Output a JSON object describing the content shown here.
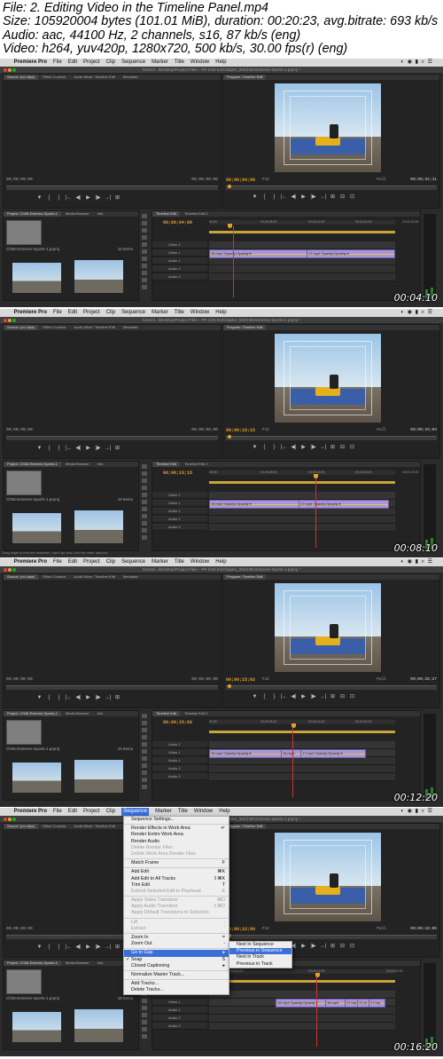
{
  "file_info": {
    "line1": "File: 2. Editing Video in the Timeline Panel.mp4",
    "line2": "Size: 105920004 bytes (101.01 MiB), duration: 00:20:23, avg.bitrate: 693 kb/s",
    "line3": "Audio: aac, 44100 Hz, 2 channels, s16, 87 kb/s (eng)",
    "line4": "Video: h264, yuv420p, 1280x720, 500 kb/s, 30.00 fps(r) (eng)"
  },
  "menubar": {
    "apple": "",
    "app": "Premiere Pro",
    "items": [
      "File",
      "Edit",
      "Project",
      "Clip",
      "Sequence",
      "Marker",
      "Title",
      "Window",
      "Help"
    ],
    "sys": "◐ ◉ ▮ ⌕ ☰"
  },
  "window_title": "/Users/.../Desktop/Project Files – PP CS6 Ex/Chapter_06/Ch06-Extreme-Sports-1.prproj *",
  "panels": {
    "source_tab": "Source: (no clips)",
    "effect_controls_tab": "Effect Controls",
    "audio_mixer_tab": "Audio Mixer: Timeline Edit",
    "metadata_tab": "Metadata",
    "program_tab": "Program: Timeline Edit",
    "project_tab": "Project: Ch06-Extreme-Sports-1",
    "media_browser_tab": "Media Browser",
    "info_tab": "Info",
    "timeline_tab": "Timeline Edit",
    "timeline_tab2": "Timeline Edit 2",
    "project_file": "Ch06-Extreme-Sports-1.prproj",
    "items_count": "15 Items",
    "fit_label": "Fit",
    "full_label": "Full",
    "source_tc_left": "00;00;00;00",
    "source_tc_right": "00;00;00;00"
  },
  "frames": [
    {
      "program_tc": "00;00;04;06",
      "program_duration": "00;00;34;11",
      "timeline_tc": "00;00;04;06",
      "ruler": [
        "00;00",
        "00;00;08;00",
        "00;00;16;00",
        "00;00;24;00",
        "00;00;32;00"
      ],
      "clips": [
        "16.mp4 Opacity:Opacity ▾",
        "17.mp4 Opacity:Opacity ▾"
      ],
      "stamp": "00:04:10",
      "status": ""
    },
    {
      "program_tc": "00;00;19;15",
      "program_duration": "00;00;33;03",
      "timeline_tc": "00;00;19;15",
      "ruler": [
        "00;00",
        "00;00;08;00",
        "00;00;16;00",
        "00;00;24;00",
        "00;00;32;00"
      ],
      "clips": [
        "16.mp4 Opacity:Opacity ▾",
        "17.mp4 Opacity:Opacity ▾"
      ],
      "stamp": "00:08:10",
      "status": "Drag edge to trim the selection. Use Opt and Cmd for other options."
    },
    {
      "program_tc": "00;00;15;02",
      "program_duration": "00;00;28;27",
      "timeline_tc": "00;00;15;02",
      "ruler": [
        "00;00",
        "00;00;08;00",
        "00;00;16;00",
        "00;00;24;00"
      ],
      "clips": [
        "16.mp4 Opacity:Opacity ▾",
        "16.mp4",
        "17.mp4 Opacity:Opacity ▾"
      ],
      "stamp": "00:12:20",
      "status": ""
    },
    {
      "program_tc": "00;00;12;00",
      "program_duration": "00;00;19;09",
      "timeline_tc": "00;00;12;00",
      "ruler": [
        "00;00;04;00",
        "00;00;12;00",
        "00;00;20;00"
      ],
      "clips": [
        "16.mp4 Opacity:Opacity ▾",
        "16.mp4",
        "17.mp",
        "17.m",
        "17.mp"
      ],
      "stamp": "00:16:20",
      "status": ""
    }
  ],
  "tracks": [
    "Video 2",
    "Video 1",
    "Audio 1",
    "Audio 2",
    "Audio 3"
  ],
  "transport_icons": [
    "▼",
    "{",
    "}",
    "|←",
    "◀|",
    "▶",
    "|▶",
    "→|",
    "⊞",
    "⊟",
    "⊡"
  ],
  "sequence_menu": {
    "items": [
      {
        "label": "Sequence Settings...",
        "sc": "",
        "dis": false
      },
      {
        "sep": true
      },
      {
        "label": "Render Effects in Work Area",
        "sc": "↵",
        "dis": false
      },
      {
        "label": "Render Entire Work Area",
        "sc": "",
        "dis": false
      },
      {
        "label": "Render Audio",
        "sc": "",
        "dis": false
      },
      {
        "label": "Delete Render Files",
        "sc": "",
        "dis": true
      },
      {
        "label": "Delete Work Area Render Files",
        "sc": "",
        "dis": true
      },
      {
        "sep": true
      },
      {
        "label": "Match Frame",
        "sc": "F",
        "dis": false
      },
      {
        "sep": true
      },
      {
        "label": "Add Edit",
        "sc": "⌘K",
        "dis": false
      },
      {
        "label": "Add Edit to All Tracks",
        "sc": "⇧⌘K",
        "dis": false
      },
      {
        "label": "Trim Edit",
        "sc": "T",
        "dis": false
      },
      {
        "label": "Extend Selected Edit to Playhead",
        "sc": "E",
        "dis": true
      },
      {
        "sep": true
      },
      {
        "label": "Apply Video Transition",
        "sc": "⌘D",
        "dis": true
      },
      {
        "label": "Apply Audio Transition",
        "sc": "⇧⌘D",
        "dis": true
      },
      {
        "label": "Apply Default Transitions to Selection",
        "sc": "",
        "dis": true
      },
      {
        "sep": true
      },
      {
        "label": "Lift",
        "sc": ";",
        "dis": true
      },
      {
        "label": "Extract",
        "sc": "'",
        "dis": true
      },
      {
        "sep": true
      },
      {
        "label": "Zoom In",
        "sc": "=",
        "dis": false
      },
      {
        "label": "Zoom Out",
        "sc": "-",
        "dis": false
      },
      {
        "sep": true
      },
      {
        "label": "Go to Gap",
        "sc": "▸",
        "dis": false,
        "hl": true
      },
      {
        "label": "Snap",
        "sc": "S",
        "dis": false,
        "check": "✓"
      },
      {
        "label": "Closed Captioning",
        "sc": "▸",
        "dis": false
      },
      {
        "sep": true
      },
      {
        "label": "Normalize Master Track...",
        "sc": "",
        "dis": false
      },
      {
        "sep": true
      },
      {
        "label": "Add Tracks...",
        "sc": "",
        "dis": false
      },
      {
        "label": "Delete Tracks...",
        "sc": "",
        "dis": false
      }
    ]
  },
  "gap_submenu": {
    "items": [
      {
        "label": "Next in Sequence",
        "hl": false
      },
      {
        "label": "Previous in Sequence",
        "hl": true
      },
      {
        "label": "Next in Track",
        "hl": false
      },
      {
        "label": "Previous in Track",
        "hl": false
      }
    ]
  }
}
